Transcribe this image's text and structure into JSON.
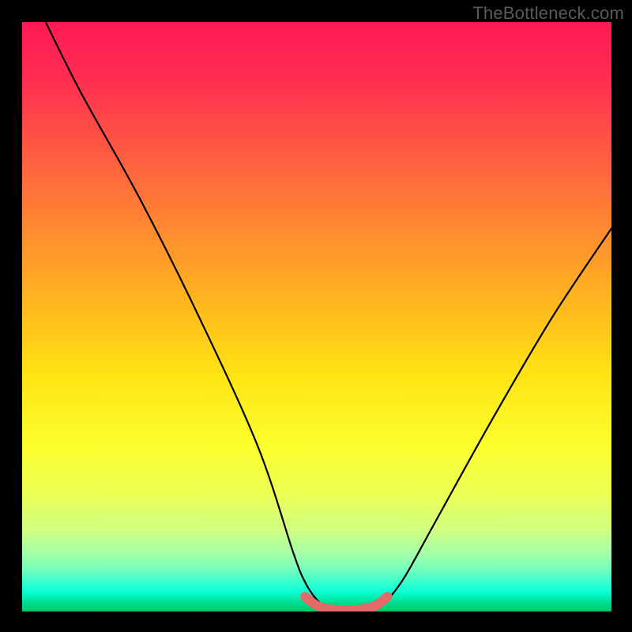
{
  "watermark": "TheBottleneck.com",
  "chart_data": {
    "type": "line",
    "title": "",
    "xlabel": "",
    "ylabel": "",
    "xlim": [
      0,
      100
    ],
    "ylim": [
      0,
      100
    ],
    "grid": false,
    "series": [
      {
        "name": "curve",
        "color": "#000000",
        "x": [
          4,
          10,
          20,
          30,
          40,
          46,
          48,
          50,
          52,
          54,
          56,
          58,
          60,
          62,
          65,
          70,
          80,
          90,
          100
        ],
        "y": [
          100,
          88,
          70,
          50,
          28,
          10,
          5,
          2,
          0.5,
          0,
          0,
          0,
          0.5,
          2,
          6,
          15,
          33,
          50,
          65
        ]
      },
      {
        "name": "highlight-floor",
        "color": "#e46a6a",
        "x": [
          48,
          50,
          52,
          54,
          56,
          58,
          60,
          62
        ],
        "y": [
          2.5,
          1.0,
          0.4,
          0.2,
          0.2,
          0.4,
          1.0,
          2.5
        ]
      }
    ],
    "background_gradient": {
      "top_colors": [
        "#ff1a55",
        "#ff3a4a",
        "#ff6a3c",
        "#ff9a2e",
        "#ffc81f",
        "#ffee14",
        "#f8ff3a",
        "#cfff6a",
        "#8fff9a",
        "#2affba",
        "#00ffc8",
        "#00ca6e"
      ],
      "style": "vertical"
    }
  }
}
